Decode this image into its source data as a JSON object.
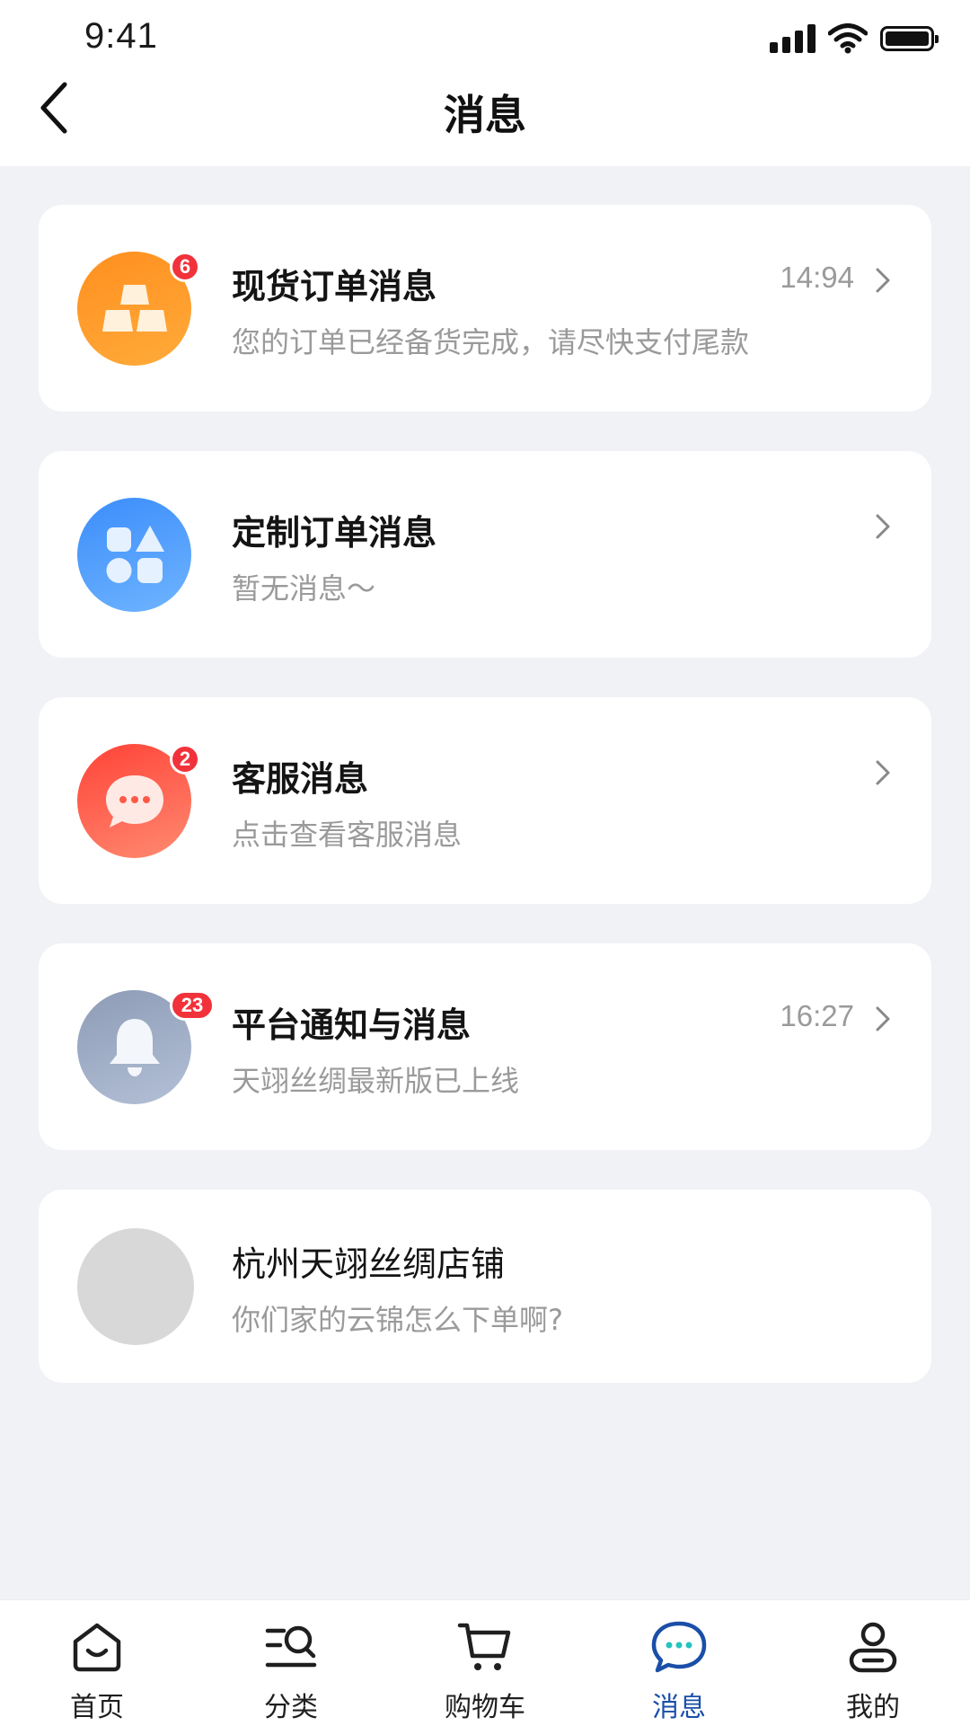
{
  "status_bar": {
    "time": "9:41"
  },
  "header": {
    "title": "消息"
  },
  "messages": [
    {
      "title": "现货订单消息",
      "subtitle": "您的订单已经备货完成，请尽快支付尾款",
      "time": "14:94",
      "badge": "6",
      "icon": "gold-bars-icon",
      "color": "#ff9a2a"
    },
    {
      "title": "定制订单消息",
      "subtitle": "暂无消息～",
      "icon": "shapes-icon",
      "color": "#4a9bfd"
    },
    {
      "title": "客服消息",
      "subtitle": "点击查看客服消息",
      "badge": "2",
      "icon": "chat-bubble-icon",
      "color": "#ff5a48"
    },
    {
      "title": "平台通知与消息",
      "subtitle": "天翊丝绸最新版已上线",
      "time": "16:27",
      "badge": "23",
      "icon": "bell-icon",
      "color": "#9eabc4"
    },
    {
      "title": "杭州天翊丝绸店铺",
      "subtitle": "你们家的云锦怎么下单啊?",
      "icon": "store-avatar"
    }
  ],
  "tabbar": {
    "items": [
      {
        "label": "首页",
        "icon": "home-icon"
      },
      {
        "label": "分类",
        "icon": "category-search-icon"
      },
      {
        "label": "购物车",
        "icon": "cart-icon"
      },
      {
        "label": "消息",
        "icon": "message-icon",
        "active": true
      },
      {
        "label": "我的",
        "icon": "profile-icon"
      }
    ]
  },
  "colors": {
    "active_tab": "#1a4fa8",
    "badge": "#f2323b",
    "background": "#f1f2f6"
  }
}
